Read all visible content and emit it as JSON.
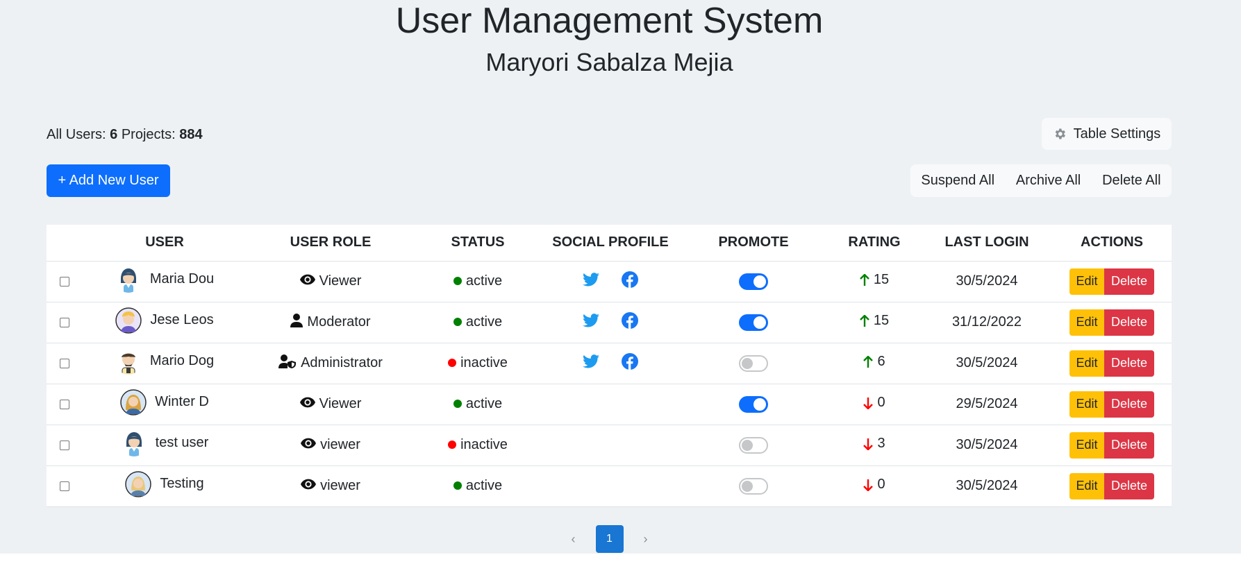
{
  "header": {
    "title": "User Management System",
    "subtitle": "Maryori Sabalza Mejia"
  },
  "summary": {
    "users_label": "All Users:",
    "users_count": "6",
    "projects_label": "Projects:",
    "projects_count": "884"
  },
  "toolbar": {
    "settings_label": "Table Settings",
    "add_label": "+ Add New User",
    "suspend_label": "Suspend All",
    "archive_label": "Archive All",
    "delete_all_label": "Delete All"
  },
  "table": {
    "headers": [
      "USER",
      "USER ROLE",
      "STATUS",
      "SOCIAL PROFILE",
      "PROMOTE",
      "RATING",
      "LAST LOGIN",
      "ACTIONS"
    ],
    "edit_label": "Edit",
    "delete_label": "Delete",
    "rows": [
      {
        "name": "Maria Dou",
        "role": "Viewer",
        "role_icon": "eye-icon",
        "status": "active",
        "social": true,
        "promote": true,
        "rating": "15",
        "trend": "up",
        "last_login": "30/5/2024"
      },
      {
        "name": "Jese Leos",
        "role": "Moderator",
        "role_icon": "user-icon",
        "status": "active",
        "social": true,
        "promote": true,
        "rating": "15",
        "trend": "up",
        "last_login": "31/12/2022"
      },
      {
        "name": "Mario Dog",
        "role": "Administrator",
        "role_icon": "user-shield-icon",
        "status": "inactive",
        "social": true,
        "promote": false,
        "rating": "6",
        "trend": "up",
        "last_login": "30/5/2024"
      },
      {
        "name": "Winter D",
        "role": "Viewer",
        "role_icon": "eye-icon",
        "status": "active",
        "social": false,
        "promote": true,
        "rating": "0",
        "trend": "down",
        "last_login": "29/5/2024"
      },
      {
        "name": "test user",
        "role": "viewer",
        "role_icon": "eye-icon",
        "status": "inactive",
        "social": false,
        "promote": false,
        "rating": "3",
        "trend": "down",
        "last_login": "30/5/2024"
      },
      {
        "name": "Testing",
        "role": "viewer",
        "role_icon": "eye-icon",
        "status": "active",
        "social": false,
        "promote": false,
        "rating": "0",
        "trend": "down",
        "last_login": "30/5/2024"
      }
    ]
  },
  "pagination": {
    "current": "1"
  },
  "colors": {
    "primary": "#0d6efd",
    "active": "#008000",
    "inactive": "#ff0000",
    "edit": "#ffc107",
    "delete": "#dc3545",
    "twitter": "#1d9bf0",
    "facebook": "#1877f2",
    "trend_up": "#008000",
    "trend_down": "#ff0000"
  }
}
